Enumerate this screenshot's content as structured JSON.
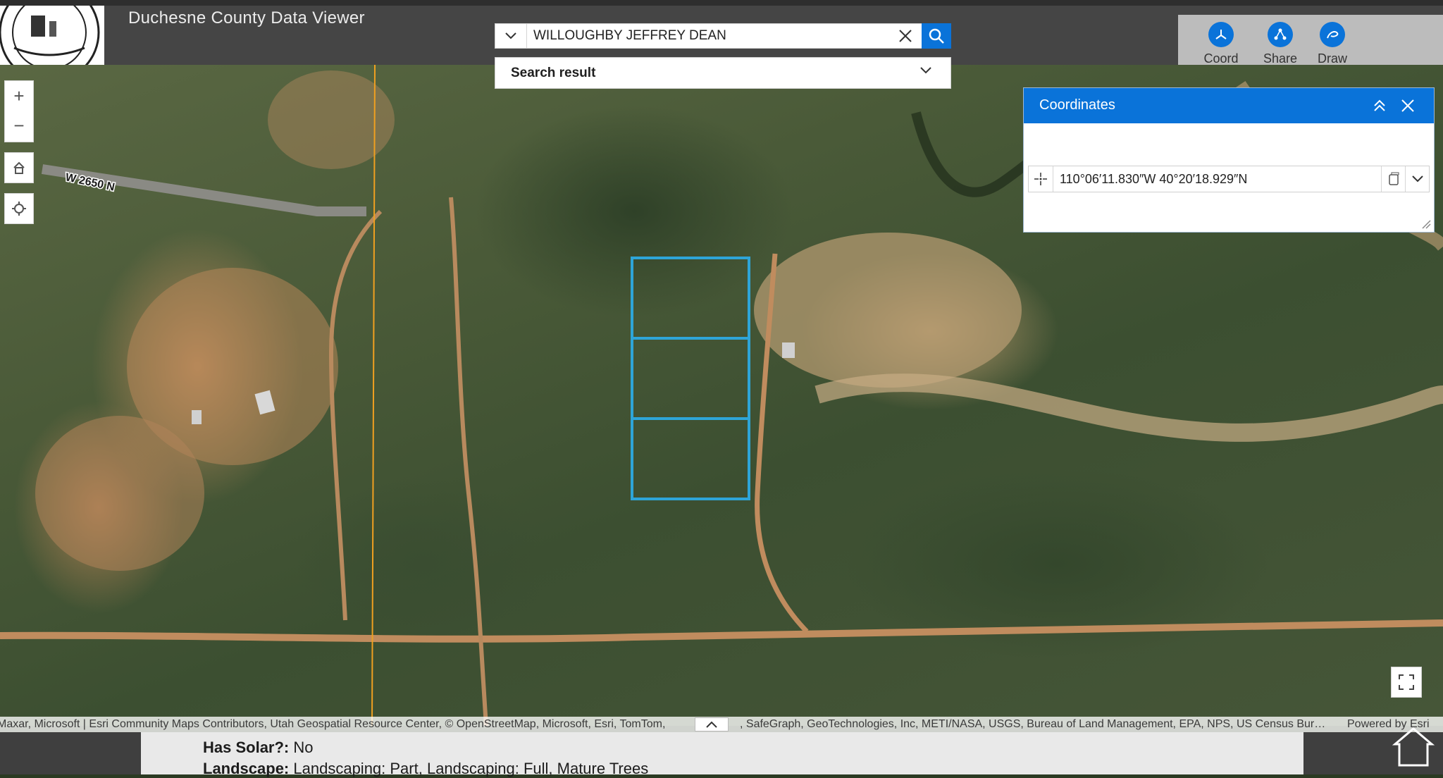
{
  "app": {
    "title": "Duchesne County Data Viewer"
  },
  "search": {
    "value": "WILLOUGHBY JEFFREY DEAN",
    "results_label": "Search result"
  },
  "toolbar": {
    "items": [
      {
        "label": "Coord",
        "icon": "coordinate-icon"
      },
      {
        "label": "Share",
        "icon": "share-icon"
      },
      {
        "label": "Draw",
        "icon": "draw-icon"
      }
    ]
  },
  "map": {
    "road_label": "W 2650 N"
  },
  "coordinates_panel": {
    "title": "Coordinates",
    "value": "110°06′11.830″W 40°20′18.929″N"
  },
  "attribution": {
    "left": "Maxar, Microsoft | Esri Community Maps Contributors, Utah Geospatial Resource Center, © OpenStreetMap, Microsoft, Esri, TomTom,",
    "right": ", SafeGraph, GeoTechnologies, Inc, METI/NASA, USGS, Bureau of Land Management, EPA, NPS, US Census Bur…",
    "powered": "Powered by Esri"
  },
  "underlying_page": {
    "line1_label": "Has Solar?:",
    "line1_value": "No",
    "line2_label": "Landscape:",
    "line2_value": "Landscaping: Part, Landscaping: Full, Mature Trees"
  },
  "colors": {
    "accent": "#0a73d9",
    "parcel_outline": "#2ea5d8",
    "boundary_line": "#f0a020",
    "header_bg": "#454545"
  }
}
